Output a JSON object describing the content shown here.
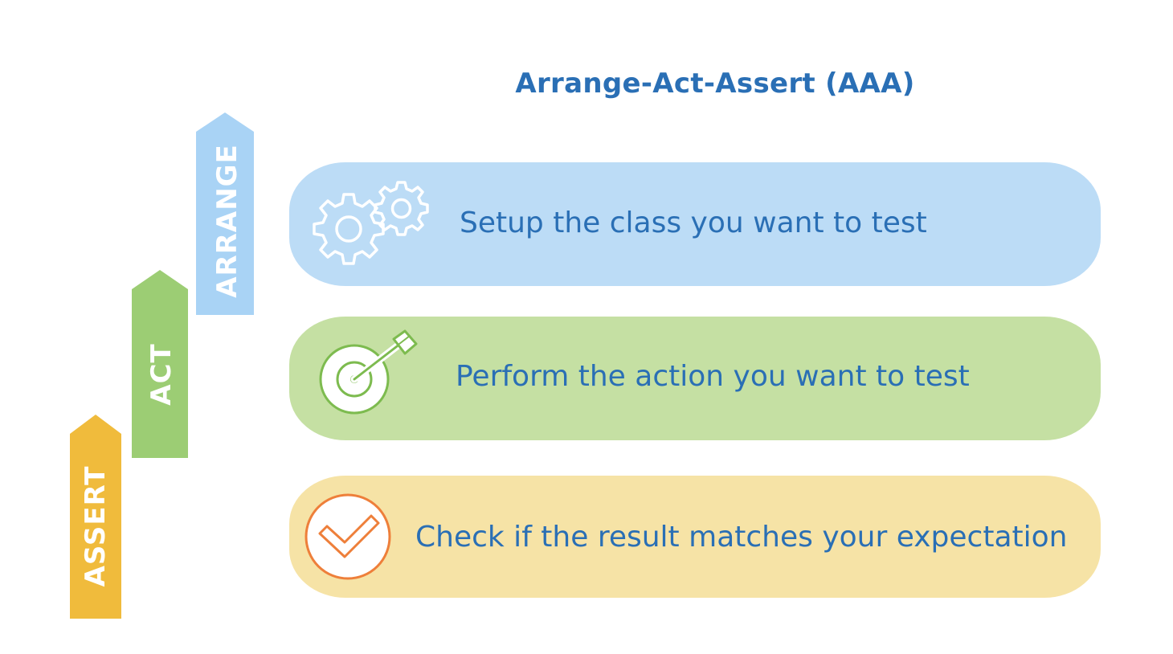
{
  "title": "Arrange-Act-Assert (AAA)",
  "arrows": [
    {
      "label": "ARRANGE",
      "color": "#a9d3f5"
    },
    {
      "label": "ACT",
      "color": "#9ccd74"
    },
    {
      "label": "ASSERT",
      "color": "#f0bb3c"
    }
  ],
  "steps": [
    {
      "text": "Setup the class you want to test",
      "icon": "gears-icon",
      "color": "#bcdcf6"
    },
    {
      "text": "Perform the action you want to test",
      "icon": "target-icon",
      "color": "#c5e0a3"
    },
    {
      "text": "Check if the result matches your expectation",
      "icon": "checkmark-circle-icon",
      "color": "#f6e3a6"
    }
  ]
}
